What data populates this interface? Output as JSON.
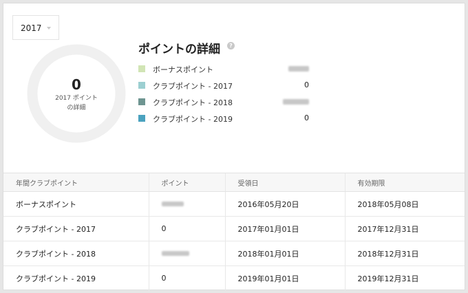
{
  "year_select": {
    "value": "2017"
  },
  "summary": {
    "total": "0",
    "caption_line1": "2017 ポイント",
    "caption_line2": "の詳細"
  },
  "detail": {
    "title": "ポイントの詳細",
    "help_icon": "question-circle-icon",
    "legend": [
      {
        "label": "ボーナスポイント",
        "value": "",
        "color": "#d1e5b5"
      },
      {
        "label": "クラブポイント - 2017",
        "value": "0",
        "color": "#9ccfd1"
      },
      {
        "label": "クラブポイント - 2018",
        "value": "",
        "color": "#6e9591"
      },
      {
        "label": "クラブポイント - 2019",
        "value": "0",
        "color": "#4ba2bf"
      }
    ]
  },
  "table": {
    "headers": [
      "年間クラブポイント",
      "ポイント",
      "受領日",
      "有効期限"
    ],
    "rows": [
      {
        "name": "ボーナスポイント",
        "points": "",
        "received": "2016年05月20日",
        "expiry": "2018年05月08日"
      },
      {
        "name": "クラブポイント - 2017",
        "points": "0",
        "received": "2017年01月01日",
        "expiry": "2017年12月31日"
      },
      {
        "name": "クラブポイント - 2018",
        "points": "",
        "received": "2018年01月01日",
        "expiry": "2018年12月31日"
      },
      {
        "name": "クラブポイント - 2019",
        "points": "0",
        "received": "2019年01月01日",
        "expiry": "2019年12月31日"
      }
    ]
  }
}
